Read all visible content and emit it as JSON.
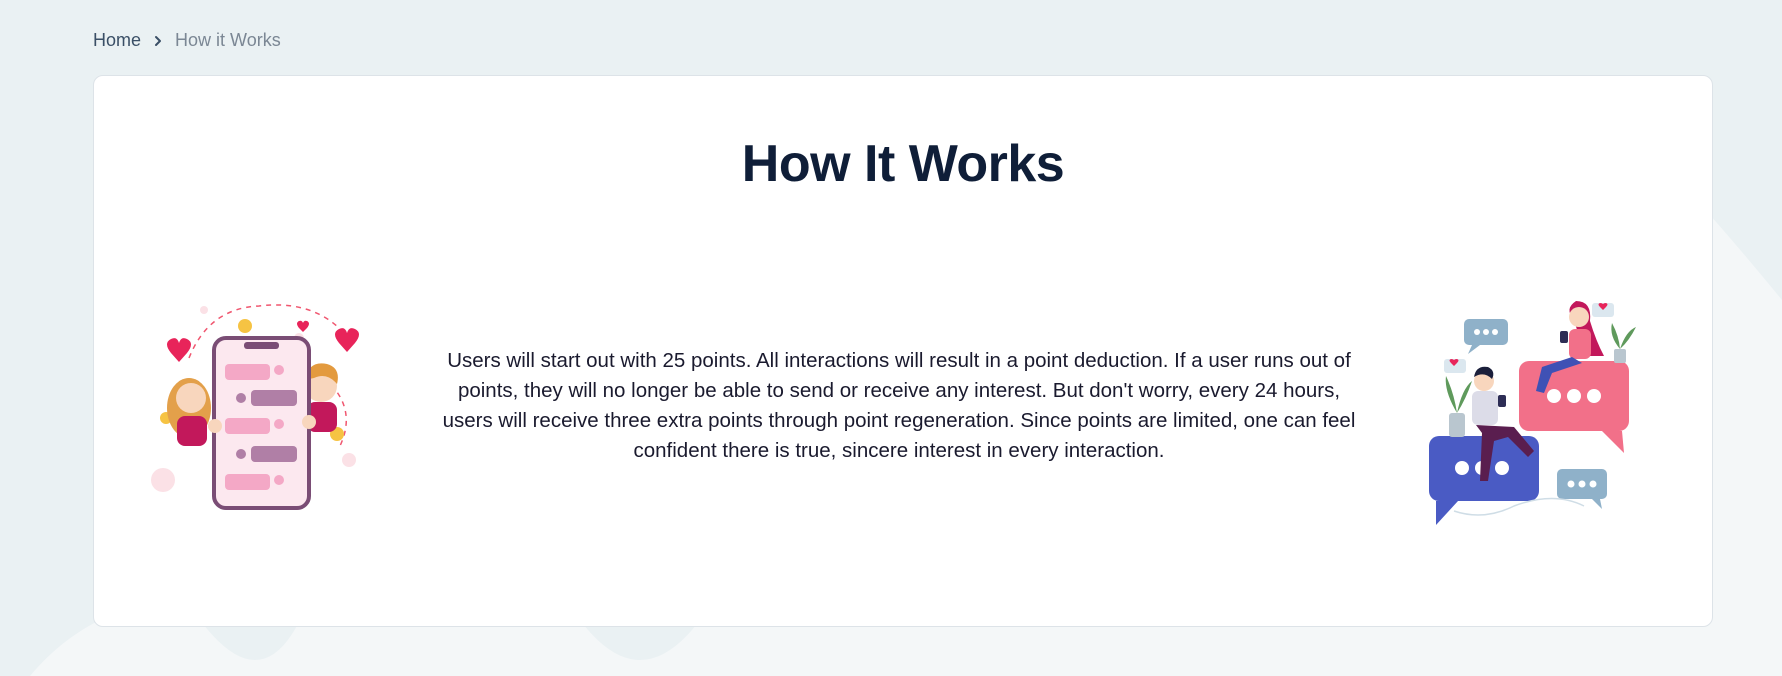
{
  "breadcrumb": {
    "home_label": "Home",
    "current_label": "How it Works"
  },
  "page": {
    "title": "How It Works",
    "description": "Users will start out with 25 points. All interactions will result in a point deduction. If a user runs out of points, they will no longer be able to send or receive any interest. But don't worry, every 24 hours, users will receive three extra points through point regeneration. Since points are limited, one can feel confident there is true, sincere interest in every interaction."
  },
  "icons": {
    "breadcrumb_separator": "chevron-right-icon",
    "left_illustration": "phone-chat-illustration",
    "right_illustration": "chat-bubbles-illustration"
  },
  "colors": {
    "background": "#f4f7f8",
    "title": "#0f1e38",
    "breadcrumb_home": "#3a4f66",
    "breadcrumb_current": "#7b8794",
    "pink_accent": "#f0566f",
    "blue_accent": "#4a5bc4"
  }
}
